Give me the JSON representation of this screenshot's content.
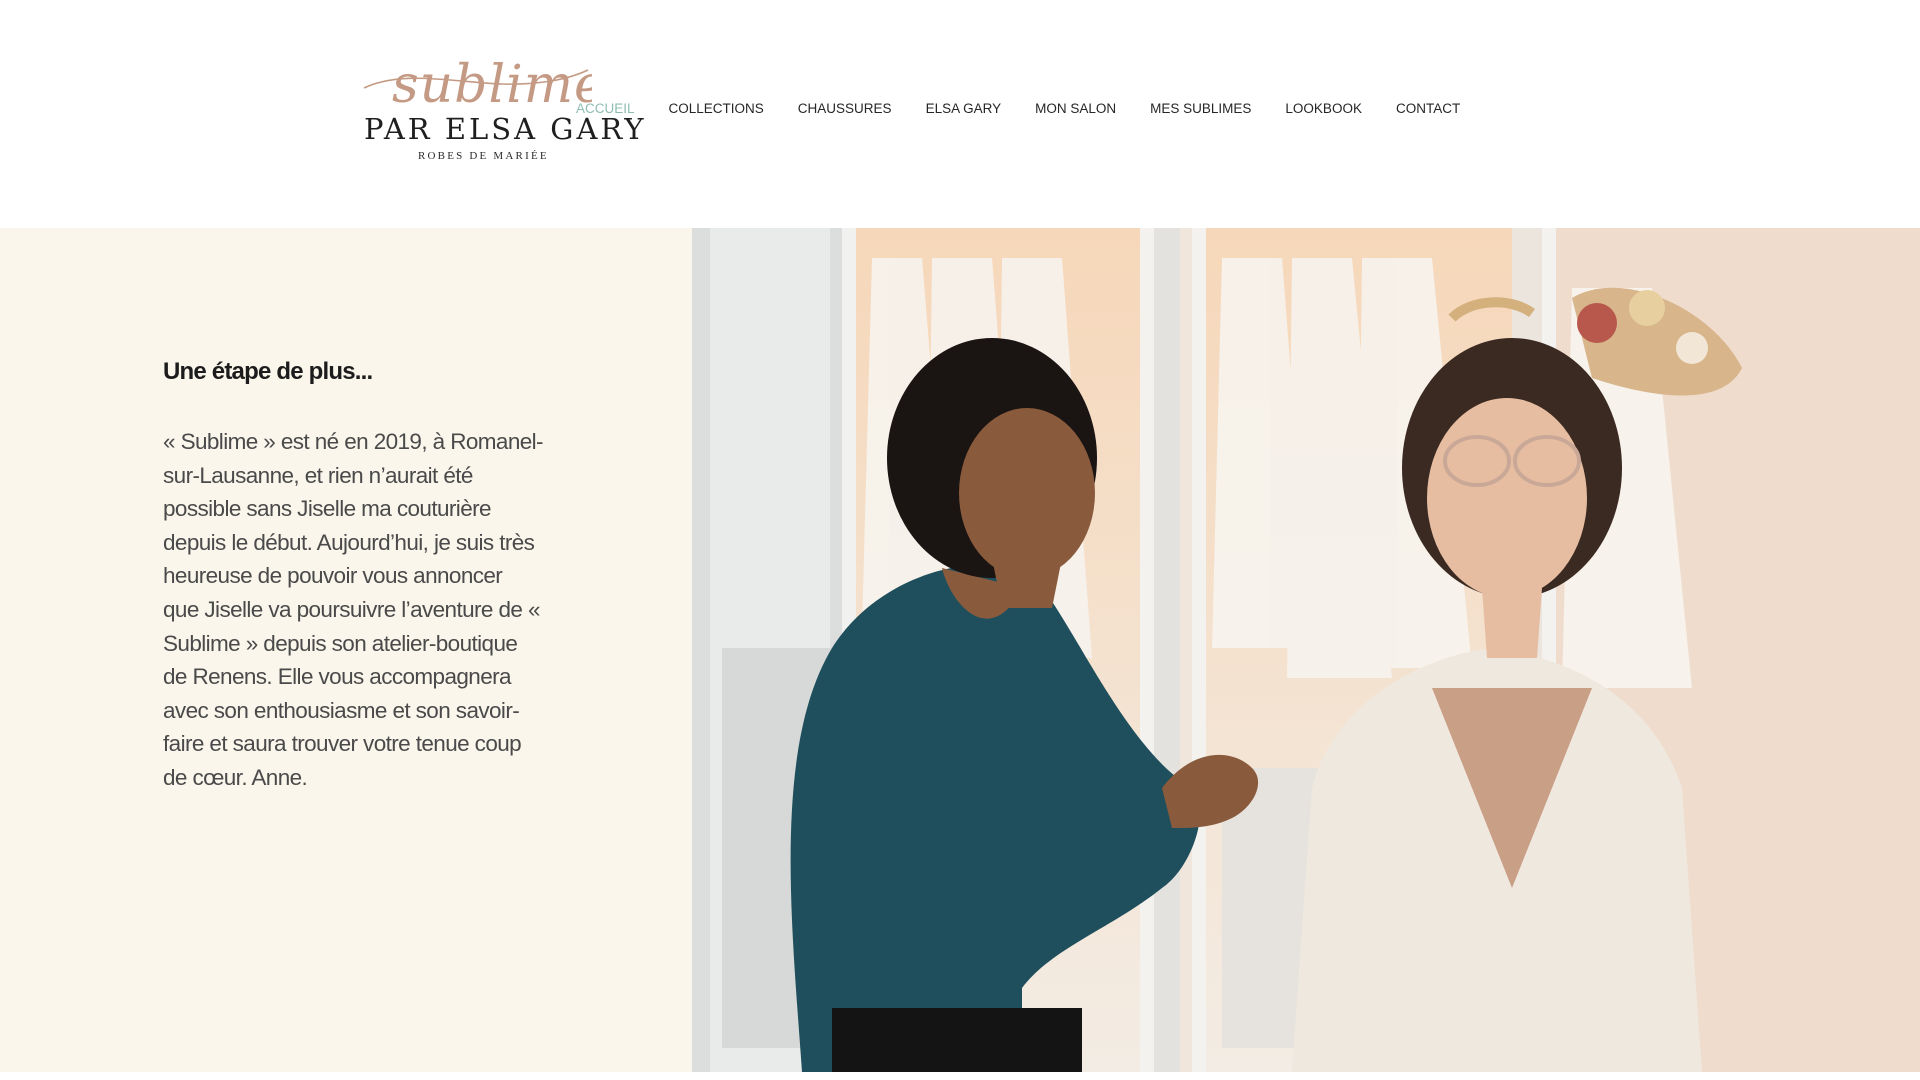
{
  "logo": {
    "script": "sublime",
    "main": "PAR ELSA GARY",
    "sub": "ROBES DE MARIÉE"
  },
  "nav": {
    "items": [
      {
        "label": "ACCUEIL",
        "active": true
      },
      {
        "label": "COLLECTIONS",
        "active": false
      },
      {
        "label": "CHAUSSURES",
        "active": false
      },
      {
        "label": "ELSA GARY",
        "active": false
      },
      {
        "label": "MON SALON",
        "active": false
      },
      {
        "label": "MES SUBLIMES",
        "active": false
      },
      {
        "label": "LOOKBOOK",
        "active": false
      },
      {
        "label": "CONTACT",
        "active": false
      }
    ]
  },
  "main": {
    "heading": "Une étape de plus...",
    "paragraph": "« Sublime » est né en 2019, à Romanel-sur-Lausanne, et rien n’aurait été possible sans Jiselle ma couturière depuis le début. Aujourd’hui, je suis très heureuse de pouvoir vous annoncer que Jiselle va poursuivre l’aventure de « Sublime » depuis son atelier-boutique de Renens. Elle vous accompagnera avec son enthousiasme et son savoir-faire et saura trouver votre tenue coup de cœur. Anne."
  },
  "colors": {
    "nav_active": "#8fbdb2",
    "logo_rose": "#c59a84",
    "panel_bg": "#faf6ec"
  }
}
